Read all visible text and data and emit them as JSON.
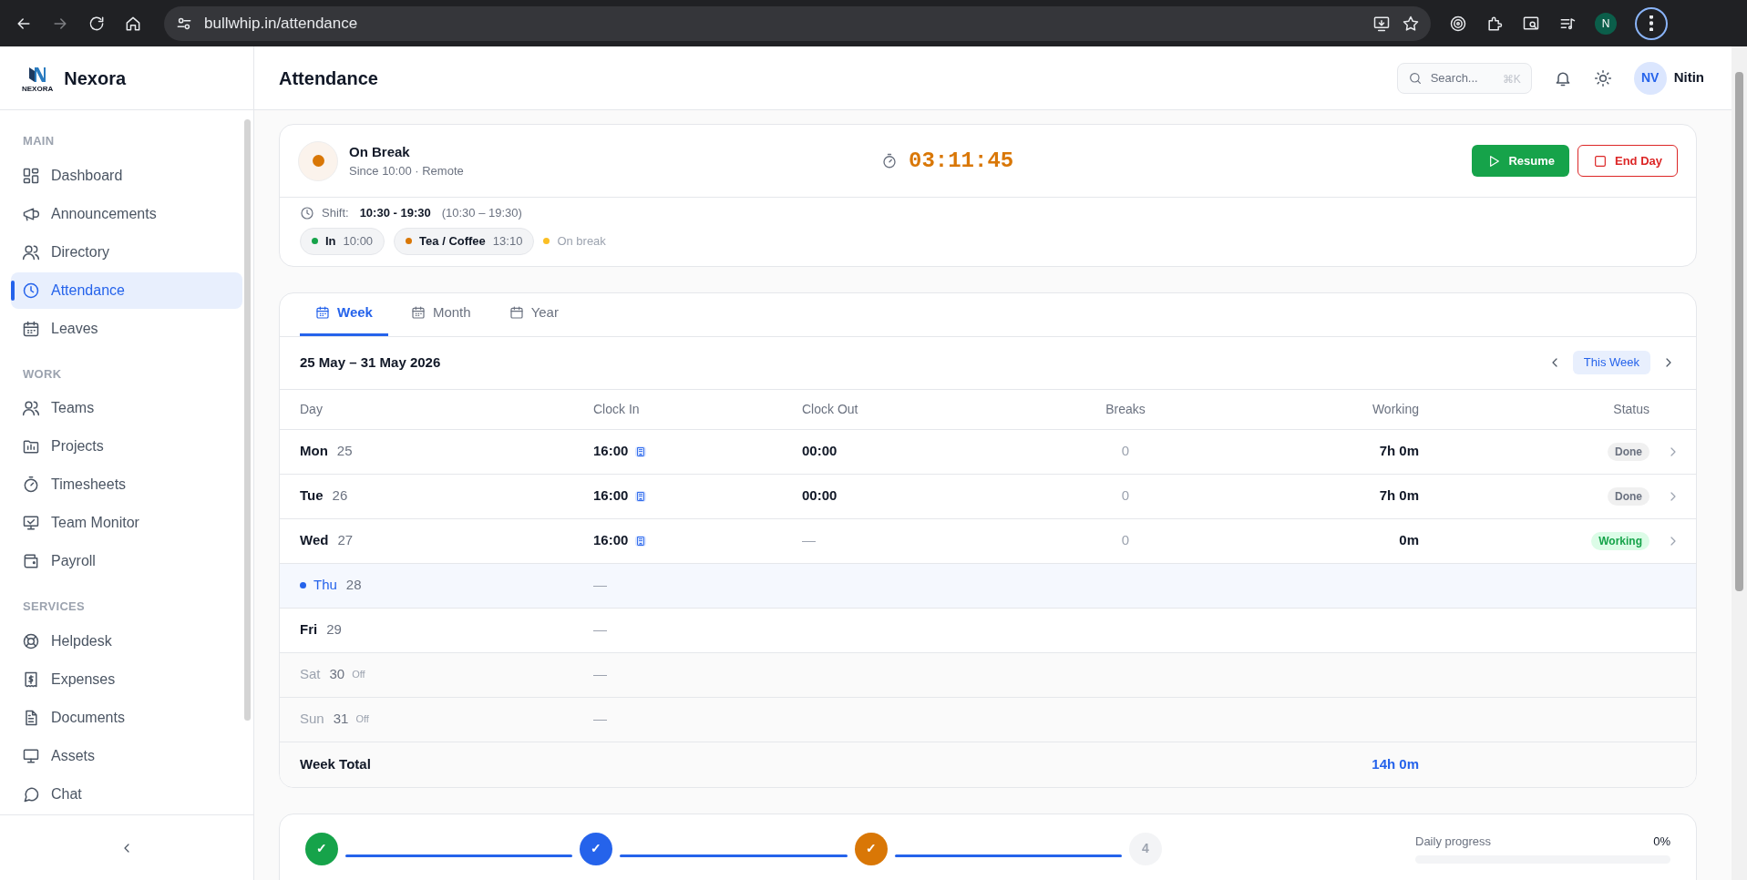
{
  "browser": {
    "url": "bullwhip.in/attendance",
    "profile": "N"
  },
  "sidebar": {
    "brand": "Nexora",
    "logo_caption": "NEXORA",
    "sections": [
      {
        "title": "MAIN",
        "items": [
          {
            "label": "Dashboard",
            "selected": false
          },
          {
            "label": "Announcements",
            "selected": false
          },
          {
            "label": "Directory",
            "selected": false
          },
          {
            "label": "Attendance",
            "selected": true
          },
          {
            "label": "Leaves",
            "selected": false
          }
        ]
      },
      {
        "title": "WORK",
        "items": [
          {
            "label": "Teams",
            "selected": false
          },
          {
            "label": "Projects",
            "selected": false
          },
          {
            "label": "Timesheets",
            "selected": false
          },
          {
            "label": "Team Monitor",
            "selected": false
          },
          {
            "label": "Payroll",
            "selected": false
          }
        ]
      },
      {
        "title": "SERVICES",
        "items": [
          {
            "label": "Helpdesk",
            "selected": false
          },
          {
            "label": "Expenses",
            "selected": false
          },
          {
            "label": "Documents",
            "selected": false
          },
          {
            "label": "Assets",
            "selected": false
          },
          {
            "label": "Chat",
            "selected": false
          }
        ]
      }
    ]
  },
  "header": {
    "title": "Attendance",
    "search": {
      "placeholder": "Search...",
      "shortcut": "⌘K"
    },
    "user": {
      "initials": "NV",
      "name": "Nitin"
    }
  },
  "status_card": {
    "status": "On Break",
    "subtitle": "Since 10:00 · Remote",
    "timer": "03:11:45",
    "buttons": [
      "Resume",
      "End Day"
    ],
    "shift_label": "Shift:",
    "shift": "10:30 - 19:30",
    "shift_range": "(10:30 – 19:30)",
    "events": [
      {
        "label": "In",
        "time": "10:00",
        "color": "#16a34a"
      },
      {
        "label": "Tea / Coffee",
        "time": "13:10",
        "color": "#d97706"
      }
    ],
    "current": {
      "label": "On break",
      "color": "#fbbf24"
    }
  },
  "tabs": [
    {
      "label": "Week",
      "selected": true
    },
    {
      "label": "Month",
      "selected": false
    },
    {
      "label": "Year",
      "selected": false
    }
  ],
  "period": {
    "range": "25 May – 31 May 2026",
    "button": "This Week"
  },
  "table": {
    "columns": [
      "Day",
      "Clock In",
      "Clock Out",
      "Breaks",
      "Working",
      "Status"
    ],
    "rows": [
      {
        "day": "Mon",
        "date": "25",
        "today": false,
        "off": false,
        "clock_in": "16:00",
        "office": true,
        "clock_out": "00:00",
        "breaks": "0",
        "working": "7h 0m",
        "status": {
          "label": "Done",
          "kind": "done"
        }
      },
      {
        "day": "Tue",
        "date": "26",
        "today": false,
        "off": false,
        "clock_in": "16:00",
        "office": true,
        "clock_out": "00:00",
        "breaks": "0",
        "working": "7h 0m",
        "status": {
          "label": "Done",
          "kind": "done"
        }
      },
      {
        "day": "Wed",
        "date": "27",
        "today": false,
        "off": false,
        "clock_in": "16:00",
        "office": true,
        "clock_out": "—",
        "breaks": "0",
        "working": "0m",
        "status": {
          "label": "Working",
          "kind": "working"
        }
      },
      {
        "day": "Thu",
        "date": "28",
        "today": true,
        "off": false,
        "clock_in": "—",
        "office": false
      },
      {
        "day": "Fri",
        "date": "29",
        "today": false,
        "off": false,
        "clock_in": "—",
        "office": false
      },
      {
        "day": "Sat",
        "date": "30",
        "today": false,
        "off": true,
        "off_label": "Off",
        "clock_in": "—",
        "office": false
      },
      {
        "day": "Sun",
        "date": "31",
        "today": false,
        "off": true,
        "off_label": "Off",
        "clock_in": "—",
        "office": false
      }
    ],
    "total": {
      "label": "Week Total",
      "working": "14h 0m"
    }
  },
  "progress": {
    "steps": [
      {
        "kind": "done",
        "label": "✓",
        "color": "#16a34a"
      },
      {
        "kind": "done",
        "label": "✓",
        "color": "#2563eb"
      },
      {
        "kind": "done",
        "label": "✓",
        "color": "#d97706"
      },
      {
        "kind": "pending",
        "label": "4"
      }
    ],
    "title": "Daily progress",
    "value": "0%",
    "level": 0
  }
}
